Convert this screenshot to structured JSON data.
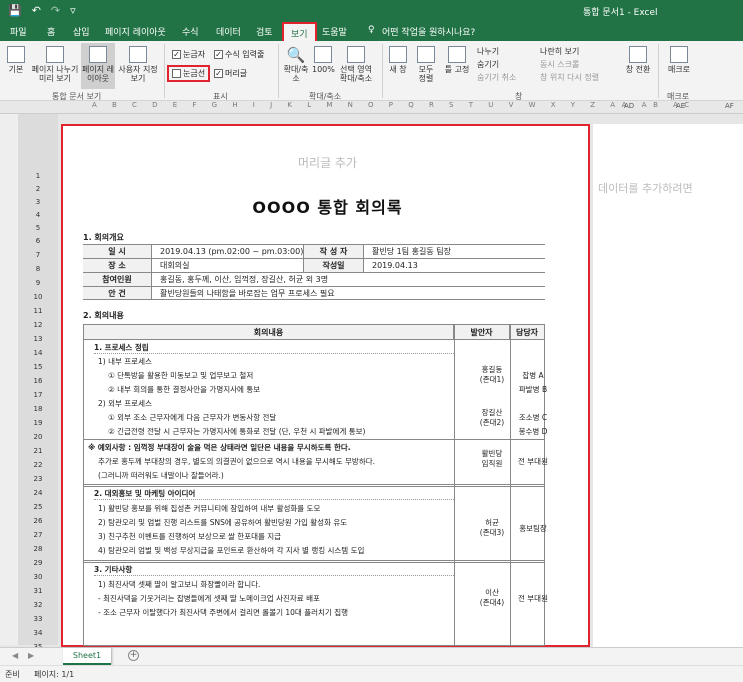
{
  "window": {
    "title": "통합 문서1 - Excel",
    "qat": [
      "💾",
      "↶",
      "↷",
      "▿"
    ]
  },
  "menu": {
    "tabs": [
      "파일",
      "홈",
      "삽입",
      "페이지 레이아웃",
      "수식",
      "데이터",
      "검토",
      "보기",
      "도움말"
    ],
    "tell_me": "어떤 작업을 원하시나요?"
  },
  "ribbon": {
    "views": [
      "기본",
      "페이지 나누기 미리 보기",
      "페이지 레이아웃",
      "사용자 지정 보기"
    ],
    "views_group": "통합 문서 보기",
    "show": {
      "ruler": "눈금자",
      "formula_bar": "수식 입력줄",
      "gridlines": "눈금선",
      "headings": "머리글",
      "ruler_checked": true,
      "formula_checked": true,
      "grid_checked": false,
      "head_checked": true
    },
    "show_group": "표시",
    "zoom": [
      "확대/축소",
      "100%",
      "선택 영역 확대/축소"
    ],
    "zoom_group": "확대/축소",
    "window_btns": [
      "새 창",
      "모두 정렬",
      "틀 고정"
    ],
    "window_small": [
      "나누기",
      "숨기기",
      "숨기기 취소",
      "나란히 보기",
      "동시 스크롤",
      "창 위치 다시 정렬"
    ],
    "switch": "창 전환",
    "window_group": "창",
    "macro": "매크로",
    "macro_group": "매크로"
  },
  "col_letters": "A B C D E F G H I J K L M N O P Q R S T U V W X Y Z AA AB AC",
  "col_letters_right": [
    "AD",
    "AE",
    "AF"
  ],
  "rows": [
    "1",
    "2",
    "3",
    "4",
    "5",
    "6",
    "7",
    "8",
    "9",
    "10",
    "11",
    "12",
    "13",
    "14",
    "15",
    "16",
    "17",
    "18",
    "19",
    "20",
    "21",
    "22",
    "23",
    "24",
    "25",
    "26",
    "27",
    "28",
    "29",
    "30",
    "31",
    "32",
    "33",
    "34",
    "35",
    "36"
  ],
  "page": {
    "header_placeholder": "머리글 추가",
    "title": "OOOO 통합 회의록",
    "add_data": "데이터를 추가하려면"
  },
  "overview": {
    "heading": "1. 회의개요",
    "date_label": "일 시",
    "date_value": "2019.04.13 (pm.02:00 ~ pm.03:00)",
    "author_label": "작 성 자",
    "author_value": "활빈당 1팀 홍길동 팀장",
    "place_label": "장 소",
    "place_value": "대회의실",
    "written_label": "작성일",
    "written_value": "2019.04.13",
    "attendees_label": "참여인원",
    "attendees_value": "홍길동, 홍두께, 이산, 임꺽정, 장길산, 허균 외 3명",
    "agenda_label": "안 건",
    "agenda_value": "활빈당원들의 나태함을 바로잡는 업무 프로세스 필요"
  },
  "content": {
    "heading": "2. 회의내용",
    "col_content": "회의내용",
    "col_proposer": "발안자",
    "col_owner": "담당자",
    "s1_title": "1. 프로세스 정립",
    "s1_l1": "1) 내부 프로세스",
    "s1_l2": "① 단톡방을 활용한 미동보고 및 업무보고 철저",
    "s1_l3": "② 내부 회의를 통한 결정사안을 가명지사에 통보",
    "s1_l4": "2) 외부 프로세스",
    "s1_l5": "① 외부 조소 근무자에게 다음 근무자가 변동사항 전달",
    "s1_l6": "② 긴급전령 전달 시 근무자는 가명지사에 통화로 전달 (단, 우천 시 파발에게 통보)",
    "s1_p1": "홍길동",
    "s1_p1b": "(존대1)",
    "s1_p2": "장길산",
    "s1_p2b": "(존대2)",
    "s1_o1": "잡병 A",
    "s1_o2": "파발병 B",
    "s1_o3": "조소병 C",
    "s1_o4": "봉수병 D",
    "note1": "※ 예외사항 : 임꺽정 부대장이 술을 먹은 상태라면 일단은 내용을 무시하도록 한다.",
    "note2": "추가로 홍두께 부대장의 경우, 별도의 의결권이 없으므로 역시 내용을 무시해도 무방하다.",
    "note3": "(그러니까 떠러워도 내말이나 잘들어라.)",
    "note_p1": "활빈당",
    "note_p2": "임직원",
    "note_o": "전 부대원",
    "s2_title": "2. 대외홍보 및 마케팅 아이디어",
    "s2_l1": "1) 활빈당 홍보를 위해 집성촌 커뮤니티에 잠입하여 내부 활성화를 도모",
    "s2_l2": "2) 탐관오리 및 엄벌 진행 리스트를 SNS에 공유하여 활빈당원 가입 활성화 유도",
    "s2_l3": "3) 친구추천 이벤트를 진행하여 보상으로 쌀 한포대를 지급",
    "s2_l4": "4) 탐관오리 엄벌 및 백성 무상지급을 포인트로 환산하여 각 지사 별 랭킹 시스템 도입",
    "s2_p1": "허균",
    "s2_p2": "(존대3)",
    "s2_o": "홍보팀장",
    "s3_title": "3. 기타사항",
    "s3_l1": "1) 최진사댁 셋째 딸이 알고보니 화장빨이라 합니다.",
    "s3_l2": "- 최진사댁을 기웃거리는 잡병들에게 셋째 딸 노메이크업 사진자료 배포",
    "s3_l3": "- 조소 근무자 이탈했다가 최진사댁 주변에서 걸리면 롤볼기 10대 플러치기 집행",
    "s3_p1": "이산",
    "s3_p2": "(존대4)",
    "s3_o": "전 부대원"
  },
  "sheet": {
    "tab": "Sheet1",
    "add": "+",
    "nav_prev": "◀",
    "nav_next": "▶"
  },
  "status": {
    "ready": "준비",
    "page": "페이지: 1/1"
  }
}
